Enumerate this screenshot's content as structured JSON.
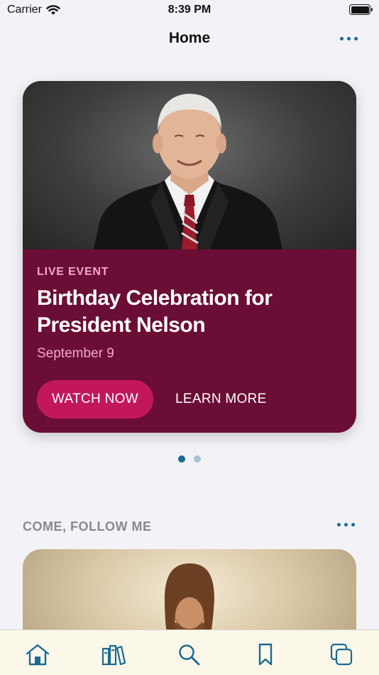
{
  "status_bar": {
    "carrier": "Carrier",
    "time": "8:39 PM"
  },
  "nav": {
    "title": "Home",
    "more_icon": "ellipsis-icon"
  },
  "hero": {
    "eyebrow": "LIVE EVENT",
    "title": "Birthday Celebration for President Nelson",
    "date": "September 9",
    "primary_button": "WATCH NOW",
    "secondary_button": "LEARN MORE",
    "colors": {
      "card": "#6b0e35",
      "accent": "#c2185b",
      "eyebrow": "#f4a7c6"
    }
  },
  "pager": {
    "active_index": 0,
    "count": 2
  },
  "section": {
    "title": "COME, FOLLOW ME",
    "more_icon": "ellipsis-icon"
  },
  "tab_bar": {
    "tabs": [
      {
        "icon": "home-icon"
      },
      {
        "icon": "library-icon"
      },
      {
        "icon": "search-icon"
      },
      {
        "icon": "bookmark-icon"
      },
      {
        "icon": "screens-icon"
      }
    ],
    "accent": "#1a6a93"
  }
}
